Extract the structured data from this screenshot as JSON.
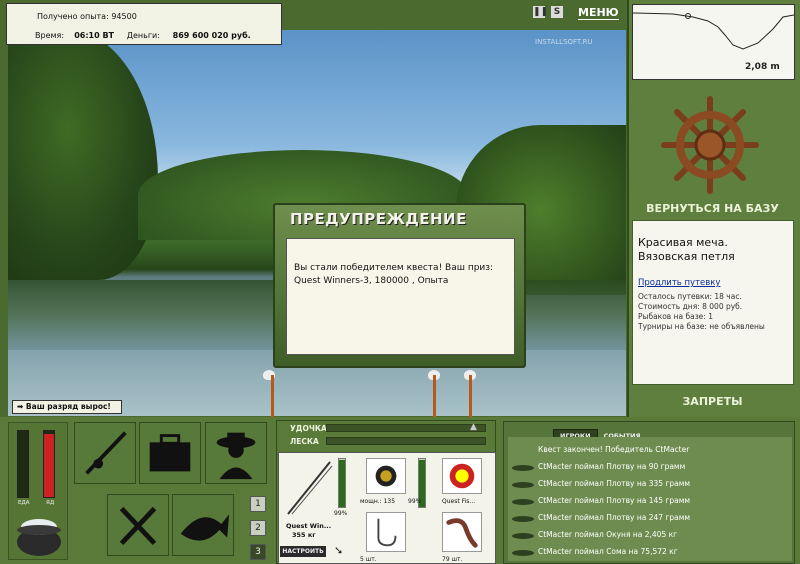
{
  "status": {
    "experience_label": "Получено опыта:",
    "experience_value": "94500",
    "time_label": "Время:",
    "time_value": "06:10 ВТ",
    "money_label": "Деньги:",
    "money_value": "869 600 020 руб."
  },
  "top": {
    "pause_icon": "pause-icon",
    "sound_label": "S",
    "menu_label": "МЕНЮ",
    "watermark": "INSTALLSOFT.RU"
  },
  "depth": {
    "value": "2,08 m"
  },
  "right": {
    "return_label": "ВЕРНУТЬСЯ НА БАЗУ",
    "place_title": "Красивая меча. Вязовская петля",
    "sell_pass": "Продлить путевку",
    "info": [
      "Осталось путевки: 18 час.",
      "Стоимость дня: 8 000 руб.",
      "Рыбаков на базе: 1",
      "Турниры на базе: не объявлены"
    ],
    "bans_label": "ЗАПРЕТЫ"
  },
  "dialog": {
    "title": "ПРЕДУПРЕЖДЕНИЕ",
    "text": "Вы стали победителем квеста! Ваш приз: Quest Winners-3, 180000 , Опыта"
  },
  "rank_notice": "Ваш разряд вырос!",
  "meters": {
    "food_label": "ЕДА",
    "bait_label": "ЯД",
    "food_level": 0.0,
    "bait_level": 0.95
  },
  "pages": [
    "1",
    "2",
    "3"
  ],
  "tackle": {
    "rod_label": "УДОЧКА",
    "line_label": "ЛЕСКА",
    "rod_name": "Quest Win...",
    "rod_weight": "355 кг",
    "rod_pct": "99%",
    "reel_caption": "мощн.: 135",
    "reel_pct": "99%",
    "lure_caption": "Quest Fis...",
    "hook_caption": "5 шт.",
    "bait_caption": "79 шт.",
    "setup_label": "НАСТРОИТЬ"
  },
  "events": {
    "tabs": [
      "ИГРОКИ",
      "СОБЫТИЯ"
    ],
    "rows": [
      "Квест закончен! Победитель CtMacter",
      "CtMacter поймал Плотву на 90 грамм",
      "CtMacter поймал Плотву на 335 грамм",
      "CtMacter поймал Плотву на 145 грамм",
      "CtMacter поймал Плотву на 247 грамм",
      "CtMacter поймал Окуня на 2,405 кг",
      "CtMacter поймал Сома на 75,572 кг"
    ]
  }
}
